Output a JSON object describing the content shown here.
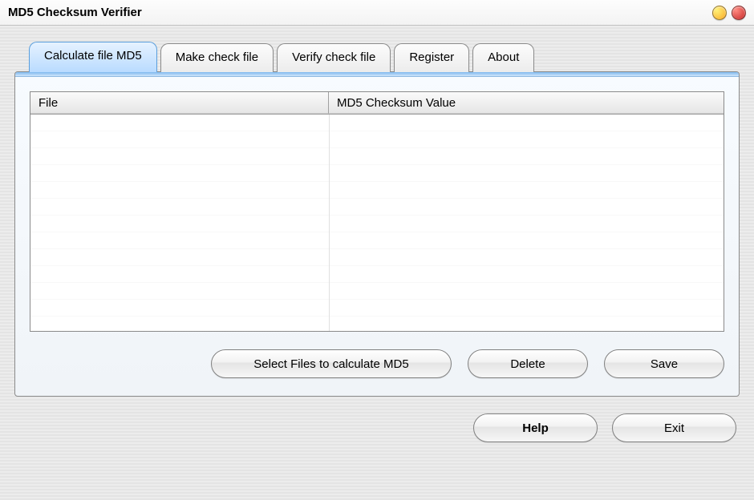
{
  "window": {
    "title": "MD5 Checksum Verifier"
  },
  "tabs": [
    {
      "label": "Calculate file MD5",
      "active": true
    },
    {
      "label": "Make check file",
      "active": false
    },
    {
      "label": "Verify check file",
      "active": false
    },
    {
      "label": "Register",
      "active": false
    },
    {
      "label": "About",
      "active": false
    }
  ],
  "table": {
    "columns": {
      "file": "File",
      "md5": "MD5 Checksum Value"
    },
    "rows": []
  },
  "panel_buttons": {
    "select": "Select Files to calculate MD5",
    "delete": "Delete",
    "save": "Save"
  },
  "footer_buttons": {
    "help": "Help",
    "exit": "Exit"
  }
}
